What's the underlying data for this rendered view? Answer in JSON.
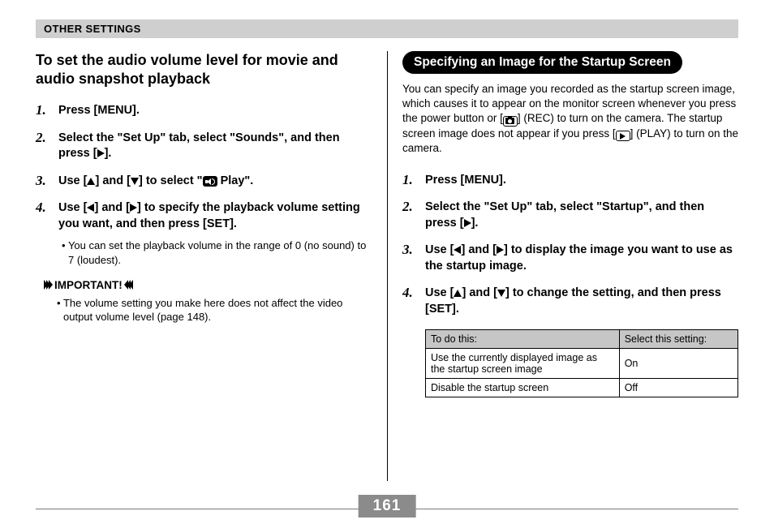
{
  "header": "OTHER SETTINGS",
  "page_number": "161",
  "left": {
    "title": "To set the audio volume level for movie and audio snapshot playback",
    "steps": [
      {
        "text_a": "Press [MENU]."
      },
      {
        "text_a": "Select the \"Set Up\" tab, select \"Sounds\", and then press [",
        "icon": "tri-r",
        "text_b": "]."
      },
      {
        "text_a": "Use [",
        "icon1": "tri-u",
        "mid1": "] and [",
        "icon2": "tri-d",
        "mid2": "] to select \"",
        "icon3": "speaker",
        "text_b": " Play\"."
      },
      {
        "text_a": "Use [",
        "icon1": "tri-l",
        "mid1": "] and [",
        "icon2": "tri-r",
        "mid2": "] to specify the playback volume setting you want, and then press [SET].",
        "sub": "You can set the playback volume in the range of 0 (no sound) to 7 (loudest)."
      }
    ],
    "important_label": "IMPORTANT!",
    "important_text": "The volume setting you make here does not affect the video output volume level (page 148)."
  },
  "right": {
    "pill": "Specifying an Image for the Startup Screen",
    "intro_a": "You can specify an image you recorded as the startup screen image, which causes it to appear on the monitor screen whenever you press the power button or [",
    "intro_b": "] (REC) to turn on the camera. The startup screen image does not appear if you press [",
    "intro_c": "] (PLAY) to turn on the camera.",
    "steps": [
      {
        "text_a": "Press [MENU]."
      },
      {
        "text_a": "Select the \"Set Up\" tab, select \"Startup\", and then press [",
        "icon": "tri-r",
        "text_b": "]."
      },
      {
        "text_a": "Use [",
        "icon1": "tri-l",
        "mid1": "] and [",
        "icon2": "tri-r",
        "mid2": "] to display the image you want to use as the startup image."
      },
      {
        "text_a": "Use [",
        "icon1": "tri-u",
        "mid1": "] and [",
        "icon2": "tri-d",
        "mid2": "] to change the setting, and then press [SET]."
      }
    ],
    "table": {
      "head": [
        "To do this:",
        "Select this setting:"
      ],
      "rows": [
        [
          "Use the currently displayed image as the startup screen image",
          "On"
        ],
        [
          "Disable the startup screen",
          "Off"
        ]
      ]
    }
  }
}
